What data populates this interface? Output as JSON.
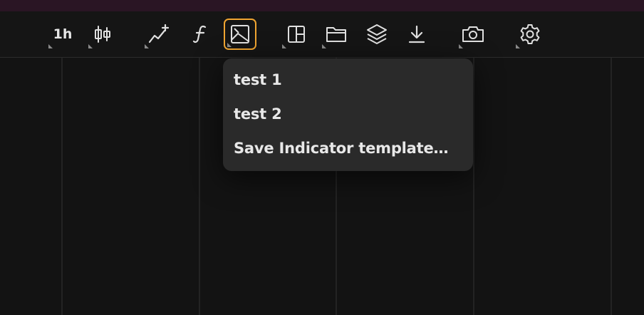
{
  "toolbar": {
    "interval_label": "1h",
    "buttons": [
      {
        "icon": "interval",
        "has_menu": true
      },
      {
        "icon": "candlestick-chart-icon",
        "has_menu": true
      },
      {
        "icon": "indicators-icon",
        "has_menu": true
      },
      {
        "icon": "function-icon",
        "has_menu": false
      },
      {
        "icon": "indicator-templates-icon",
        "has_menu": true,
        "active": true
      },
      {
        "icon": "layout-icon",
        "has_menu": true
      },
      {
        "icon": "folder-icon",
        "has_menu": true
      },
      {
        "icon": "layers-icon",
        "has_menu": false
      },
      {
        "icon": "download-icon",
        "has_menu": false
      },
      {
        "icon": "camera-icon",
        "has_menu": true
      },
      {
        "icon": "gear-icon",
        "has_menu": true
      }
    ]
  },
  "dropdown": {
    "items": [
      {
        "label": "test 1"
      },
      {
        "label": "test 2"
      },
      {
        "label": "Save Indicator template…"
      }
    ]
  },
  "colors": {
    "background": "#131313",
    "toolbar": "#151515",
    "top_strip": "#2a1524",
    "accent": "#f0a531",
    "menu": "#2a2a2a",
    "text": "#e8e8e8"
  }
}
